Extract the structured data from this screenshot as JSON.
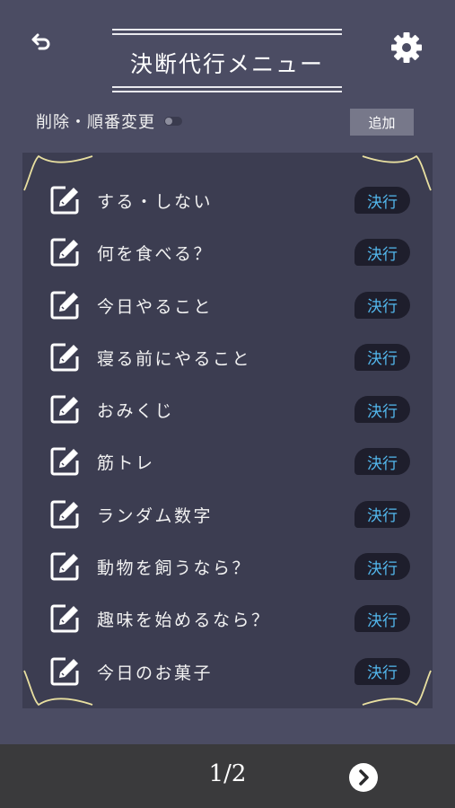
{
  "header": {
    "title": "決断代行メニュー",
    "back_icon": "return-arrow-icon",
    "settings_icon": "gear-icon"
  },
  "toolbar": {
    "reorder_label": "削除・順番変更",
    "add_label": "追加"
  },
  "menu": {
    "items": [
      {
        "label": "する・しない",
        "action": "決行"
      },
      {
        "label": "何を食べる？",
        "action": "決行"
      },
      {
        "label": "今日やること",
        "action": "決行"
      },
      {
        "label": "寝る前にやること",
        "action": "決行"
      },
      {
        "label": "おみくじ",
        "action": "決行"
      },
      {
        "label": "筋トレ",
        "action": "決行"
      },
      {
        "label": "ランダム数字",
        "action": "決行"
      },
      {
        "label": "動物を飼うなら？",
        "action": "決行"
      },
      {
        "label": "趣味を始めるなら？",
        "action": "決行"
      },
      {
        "label": "今日のお菓子",
        "action": "決行"
      }
    ]
  },
  "footer": {
    "page": "1/2",
    "next_icon": "chevron-right-icon"
  },
  "colors": {
    "background": "#4b4c63",
    "panel": "#3c3d51",
    "accent": "#53b8ee",
    "footer": "#3a3a3c",
    "ornament": "#e8dfa0"
  }
}
